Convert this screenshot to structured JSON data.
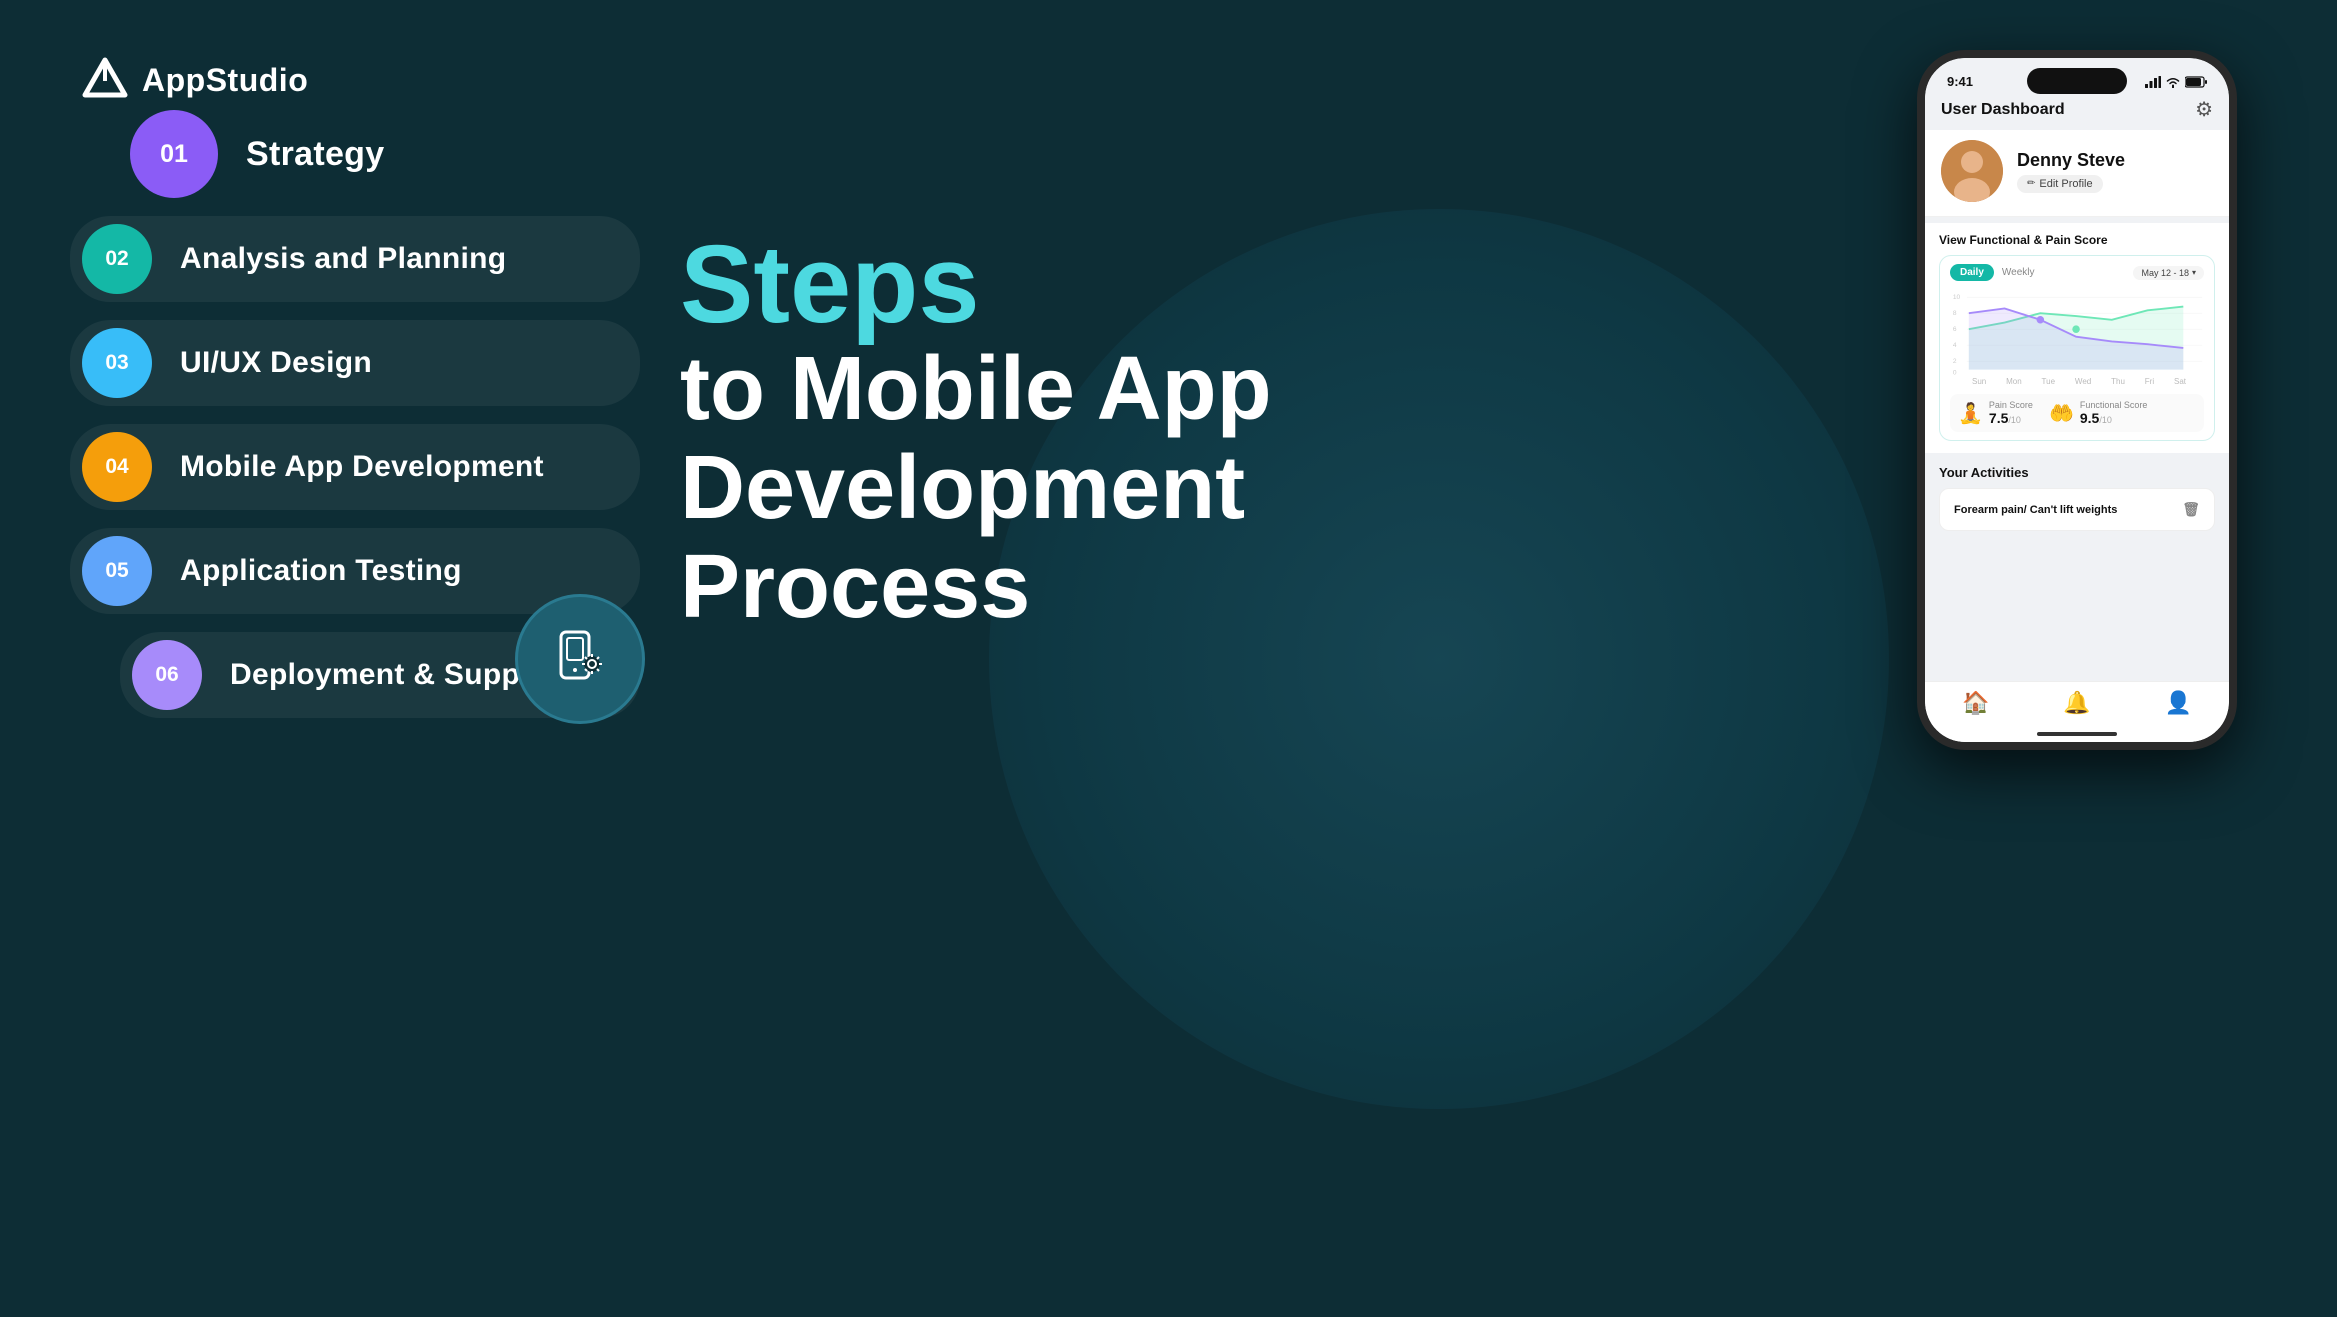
{
  "brand": {
    "name": "AppStudio"
  },
  "heading": {
    "line1": "Steps",
    "line2": "to Mobile App",
    "line3": "Development",
    "line4": "Process"
  },
  "steps": [
    {
      "number": "01",
      "label": "Strategy",
      "color": "#8b5cf6",
      "size": "large"
    },
    {
      "number": "02",
      "label": "Analysis and Planning",
      "color": "#14b8a6",
      "size": "normal"
    },
    {
      "number": "03",
      "label": "UI/UX Design",
      "color": "#38bdf8",
      "size": "normal"
    },
    {
      "number": "04",
      "label": "Mobile App Development",
      "color": "#f59e0b",
      "size": "normal"
    },
    {
      "number": "05",
      "label": "Application Testing",
      "color": "#60a5fa",
      "size": "normal"
    },
    {
      "number": "06",
      "label": "Deployment & Support",
      "color": "#a78bfa",
      "size": "normal"
    }
  ],
  "phone": {
    "status": {
      "time": "9:41",
      "signal": "●●●",
      "wifi": "wifi",
      "battery": "battery"
    },
    "dashboard": {
      "title": "User Dashboard",
      "profile": {
        "name": "Denny Steve",
        "edit_label": "Edit Profile"
      },
      "score_section": {
        "title": "View Functional & Pain Score",
        "tab_daily": "Daily",
        "tab_weekly": "Weekly",
        "date_range": "May 12 - 18",
        "x_labels": [
          "Sun",
          "Mon",
          "Tue",
          "Wed",
          "Thu",
          "Fri",
          "Sat"
        ],
        "pain_score": "7.5",
        "pain_denom": "/10",
        "pain_label": "Pain Score",
        "functional_score": "9.5",
        "functional_denom": "/10",
        "functional_label": "Functional Score"
      },
      "activities": {
        "title": "Your Activities",
        "items": [
          {
            "text": "Forearm pain/ Can't lift weights"
          }
        ]
      }
    },
    "bottom_nav": [
      "home",
      "bell",
      "person"
    ]
  }
}
